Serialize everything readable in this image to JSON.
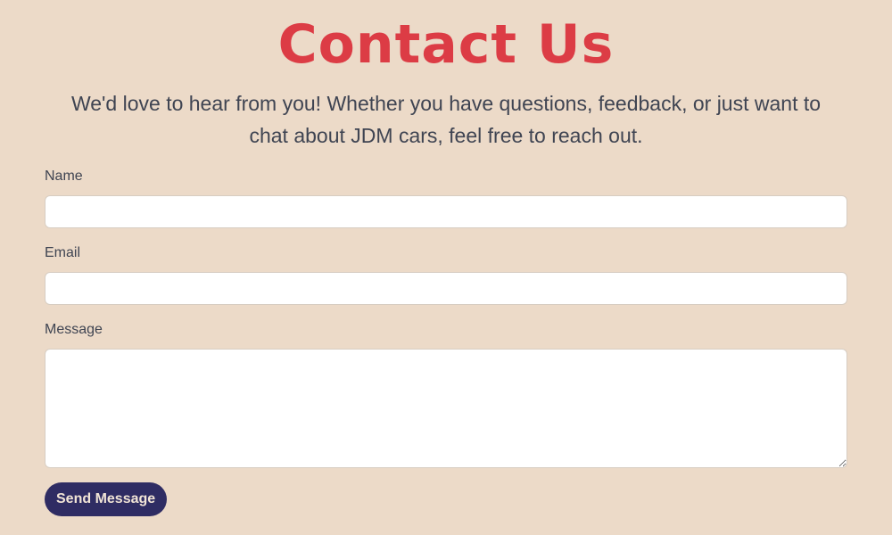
{
  "header": {
    "title": "Contact Us",
    "intro": "We'd love to hear from you! Whether you have questions, feedback, or just want to chat about JDM cars, feel free to reach out."
  },
  "form": {
    "name": {
      "label": "Name",
      "value": "",
      "placeholder": ""
    },
    "email": {
      "label": "Email",
      "value": "",
      "placeholder": ""
    },
    "message": {
      "label": "Message",
      "value": "",
      "placeholder": ""
    },
    "submit_label": "Send Message"
  },
  "colors": {
    "background": "#ecdac8",
    "title": "#dc3c45",
    "text": "#3f4452",
    "button": "#2f2c63",
    "button_text": "#f1e4d6"
  }
}
